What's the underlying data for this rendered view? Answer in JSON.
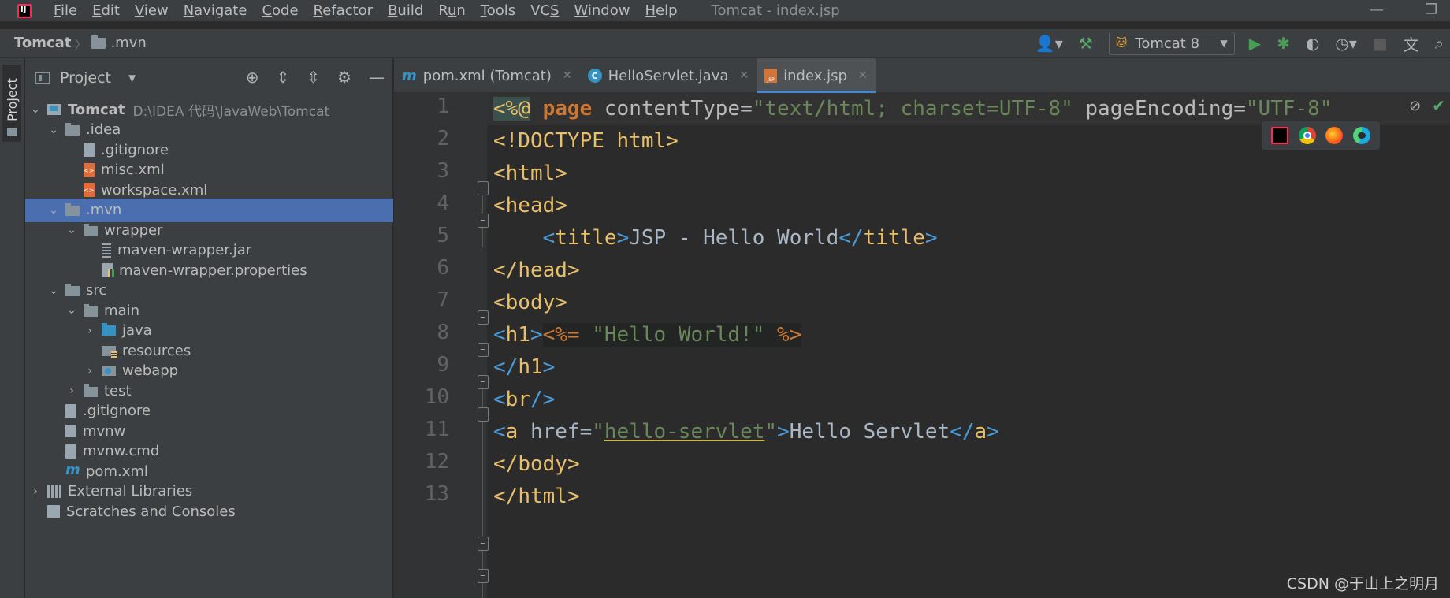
{
  "menu": {
    "items": [
      "File",
      "Edit",
      "View",
      "Navigate",
      "Code",
      "Refactor",
      "Build",
      "Run",
      "Tools",
      "VCS",
      "Window",
      "Help"
    ],
    "mnemonics": [
      "F",
      "E",
      "V",
      "N",
      "C",
      "R",
      "B",
      "u",
      "T",
      "S",
      "W",
      "H"
    ],
    "window_title": "Tomcat - index.jsp"
  },
  "navbar": {
    "root": "Tomcat",
    "folder": ".mvn",
    "run_config": "Tomcat 8"
  },
  "left_strip": {
    "tab_label": "Project"
  },
  "project_panel": {
    "title": "Project",
    "tree": [
      {
        "label": "Tomcat",
        "path": "D:\\IDEA 代码\\JavaWeb\\Tomcat",
        "depth": 0,
        "arrow": "down",
        "icon": "module-folder-icon",
        "bold": true
      },
      {
        "label": ".idea",
        "depth": 1,
        "arrow": "down",
        "icon": "folder-icon"
      },
      {
        "label": ".gitignore",
        "depth": 2,
        "arrow": "",
        "icon": "gitignore-file-icon"
      },
      {
        "label": "misc.xml",
        "depth": 2,
        "arrow": "",
        "icon": "xml-file-icon"
      },
      {
        "label": "workspace.xml",
        "depth": 2,
        "arrow": "",
        "icon": "xml-file-icon"
      },
      {
        "label": ".mvn",
        "depth": 1,
        "arrow": "down",
        "icon": "folder-icon",
        "selected": true
      },
      {
        "label": "wrapper",
        "depth": 2,
        "arrow": "down",
        "icon": "folder-icon"
      },
      {
        "label": "maven-wrapper.jar",
        "depth": 3,
        "arrow": "",
        "icon": "jar-file-icon"
      },
      {
        "label": "maven-wrapper.properties",
        "depth": 3,
        "arrow": "",
        "icon": "properties-file-icon"
      },
      {
        "label": "src",
        "depth": 1,
        "arrow": "down",
        "icon": "folder-icon"
      },
      {
        "label": "main",
        "depth": 2,
        "arrow": "down",
        "icon": "folder-icon"
      },
      {
        "label": "java",
        "depth": 3,
        "arrow": "right",
        "icon": "source-folder-icon"
      },
      {
        "label": "resources",
        "depth": 3,
        "arrow": "",
        "icon": "resources-folder-icon"
      },
      {
        "label": "webapp",
        "depth": 3,
        "arrow": "right",
        "icon": "web-folder-icon"
      },
      {
        "label": "test",
        "depth": 2,
        "arrow": "right",
        "icon": "folder-icon"
      },
      {
        "label": ".gitignore",
        "depth": 1,
        "arrow": "",
        "icon": "gitignore-file-icon"
      },
      {
        "label": "mvnw",
        "depth": 1,
        "arrow": "",
        "icon": "script-file-icon"
      },
      {
        "label": "mvnw.cmd",
        "depth": 1,
        "arrow": "",
        "icon": "cmd-file-icon"
      },
      {
        "label": "pom.xml",
        "depth": 1,
        "arrow": "",
        "icon": "maven-icon"
      },
      {
        "label": "External Libraries",
        "depth": 0,
        "arrow": "right",
        "icon": "libraries-icon"
      },
      {
        "label": "Scratches and Consoles",
        "depth": 0,
        "arrow": "",
        "icon": "scratches-icon"
      }
    ]
  },
  "tabs": [
    {
      "label": "pom.xml (Tomcat)",
      "icon": "maven-icon",
      "active": false
    },
    {
      "label": "HelloServlet.java",
      "icon": "java-class-icon",
      "active": false
    },
    {
      "label": "index.jsp",
      "icon": "jsp-file-icon",
      "active": true
    }
  ],
  "editor": {
    "line_numbers": [
      "1",
      "2",
      "3",
      "4",
      "5",
      "6",
      "7",
      "8",
      "9",
      "10",
      "11",
      "12",
      "13"
    ],
    "code": {
      "l1": {
        "open": "<%@",
        "page": "page",
        "a1": " contentType=",
        "v1": "\"text/html; charset=UTF-8\"",
        "a2": " pageEncoding=",
        "v2": "\"UTF-8\""
      },
      "l2": {
        "text": "<!DOCTYPE html>"
      },
      "l3": {
        "lt": "<",
        "tag": "html",
        "gt": ">"
      },
      "l4": {
        "lt": "<",
        "tag": "head",
        "gt": ">"
      },
      "l5": {
        "lt": "<",
        "tag": "title",
        "gt": ">",
        "text": "JSP - Hello World",
        "lt2": "</",
        "tag2": "title",
        "gt2": ">"
      },
      "l6": {
        "lt": "</",
        "tag": "head",
        "gt": ">"
      },
      "l7": {
        "lt": "<",
        "tag": "body",
        "gt": ">"
      },
      "l8": {
        "lt": "<",
        "tag": "h1",
        "gt": ">",
        "open": "<%=",
        "str": " \"Hello World!\" ",
        "close": "%>"
      },
      "l9": {
        "lt": "</",
        "tag": "h1",
        "gt": ">"
      },
      "l10": {
        "lt": "<",
        "tag": "br",
        "gt": "/>"
      },
      "l11": {
        "lt": "<",
        "tag": "a",
        "attr": " href=",
        "q1": "\"",
        "link": "hello-servlet",
        "q2": "\"",
        "gt": ">",
        "text": "Hello Servlet",
        "lt2": "</",
        "tag2": "a",
        "gt2": ">"
      },
      "l12": {
        "lt": "</",
        "tag": "body",
        "gt": ">"
      },
      "l13": {
        "lt": "</",
        "tag": "html",
        "gt": ">"
      }
    },
    "browsers": [
      "intellij-icon",
      "chrome-icon",
      "firefox-icon",
      "edge-icon"
    ]
  },
  "watermark": "CSDN @于山上之明月",
  "colors": {
    "background": "#2b2b2b",
    "panel": "#3c3f41",
    "selection": "#4b6eaf",
    "tag": "#e8bf6a",
    "string": "#6a8759",
    "keyword": "#cc7832",
    "bracket": "#4a9bd8"
  }
}
